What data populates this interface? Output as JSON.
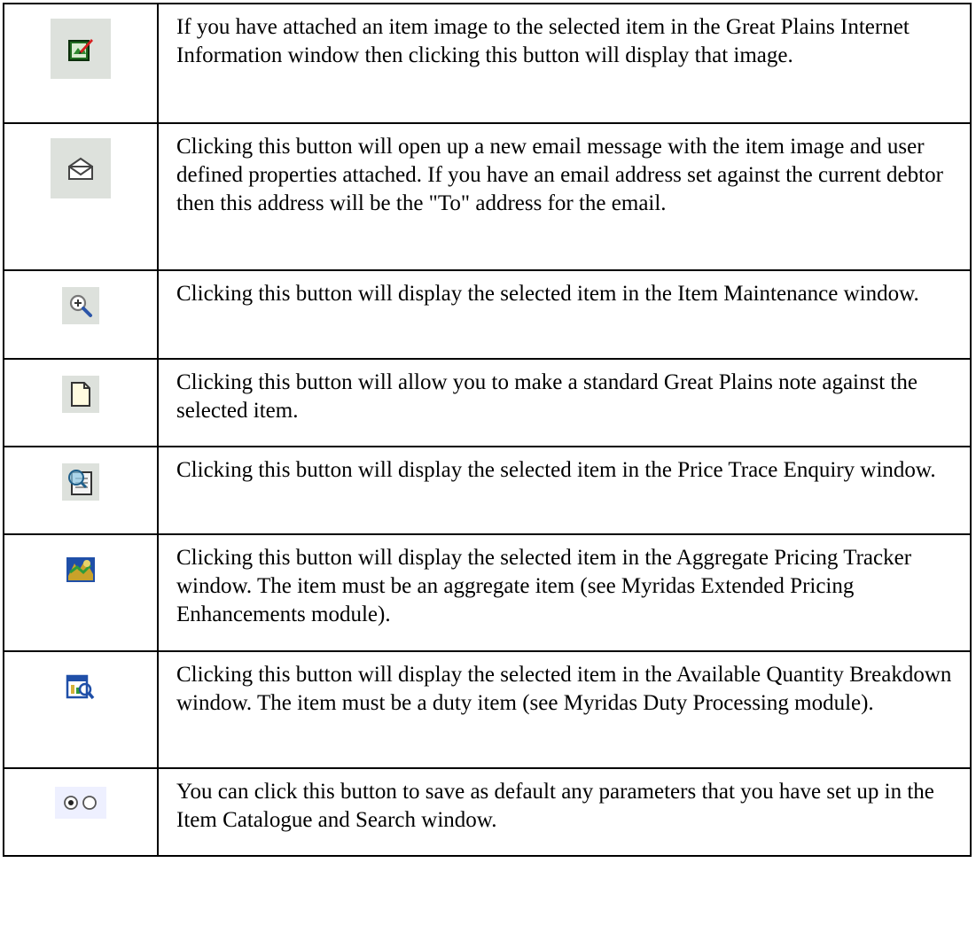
{
  "rows": [
    {
      "icon": "item-image-icon",
      "description": "If you have attached an item image to the selected item in the Great Plains Internet Information window then clicking this button will display that image."
    },
    {
      "icon": "email-envelope-icon",
      "description": "Clicking this button will open up a new email message with the item image and user defined properties attached. If you have an email address set against the current debtor then this address will be the \"To\" address for the email."
    },
    {
      "icon": "zoom-magnifier-icon",
      "description": "Clicking this button will display the selected item in the Item Maintenance window."
    },
    {
      "icon": "note-icon",
      "description": "Clicking this button will allow you to make a standard Great Plains note against the selected item."
    },
    {
      "icon": "price-trace-icon",
      "description": "Clicking this button will display the selected item in the Price Trace Enquiry window."
    },
    {
      "icon": "aggregate-pricing-icon",
      "description": "Clicking this button will display the selected item in the Aggregate Pricing Tracker window. The item must be an aggregate item (see Myridas Extended Pricing Enhancements module)."
    },
    {
      "icon": "quantity-breakdown-icon",
      "description": "Clicking this button will display the selected item in the Available Quantity Breakdown window. The item must be a duty item (see Myridas Duty Processing module)."
    },
    {
      "icon": "save-defaults-radio-icon",
      "description": "You can click this button to save as default any parameters that you have set up in the Item Catalogue and Search window."
    }
  ]
}
